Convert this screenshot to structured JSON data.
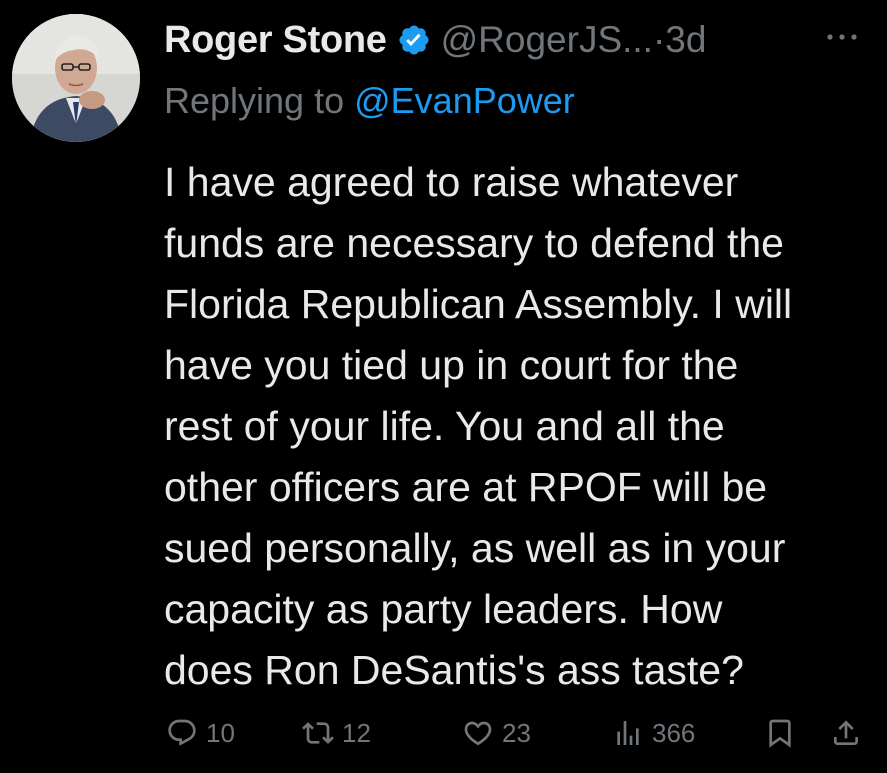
{
  "tweet": {
    "author": {
      "display_name": "Roger Stone",
      "handle": "@RogerJS...",
      "verified": true,
      "avatar": "avatar"
    },
    "separator": "·",
    "timestamp": "3d",
    "reply": {
      "prefix": "Replying to",
      "handle": "@EvanPower"
    },
    "text_lines": [
      "I have agreed to raise whatever",
      "funds are necessary to defend the",
      "Florida Republican Assembly. I will",
      "have you tied up in court for the",
      "rest of your life. You and all the",
      "other officers are at RPOF will be",
      "sued personally, as well as in your",
      "capacity as party leaders. How",
      "does Ron DeSantis's ass taste?"
    ],
    "actions": {
      "replies": "10",
      "retweets": "12",
      "likes": "23",
      "views": "366"
    }
  },
  "icons": {
    "verified": "verified-badge-icon",
    "more": "more-icon",
    "reply": "reply-icon",
    "retweet": "retweet-icon",
    "like": "heart-icon",
    "views": "views-icon",
    "bookmark": "bookmark-icon",
    "share": "share-icon"
  },
  "colors": {
    "background": "#000000",
    "primary_text": "#e7e9ea",
    "secondary_text": "#71767b",
    "accent": "#1d9bf0"
  }
}
